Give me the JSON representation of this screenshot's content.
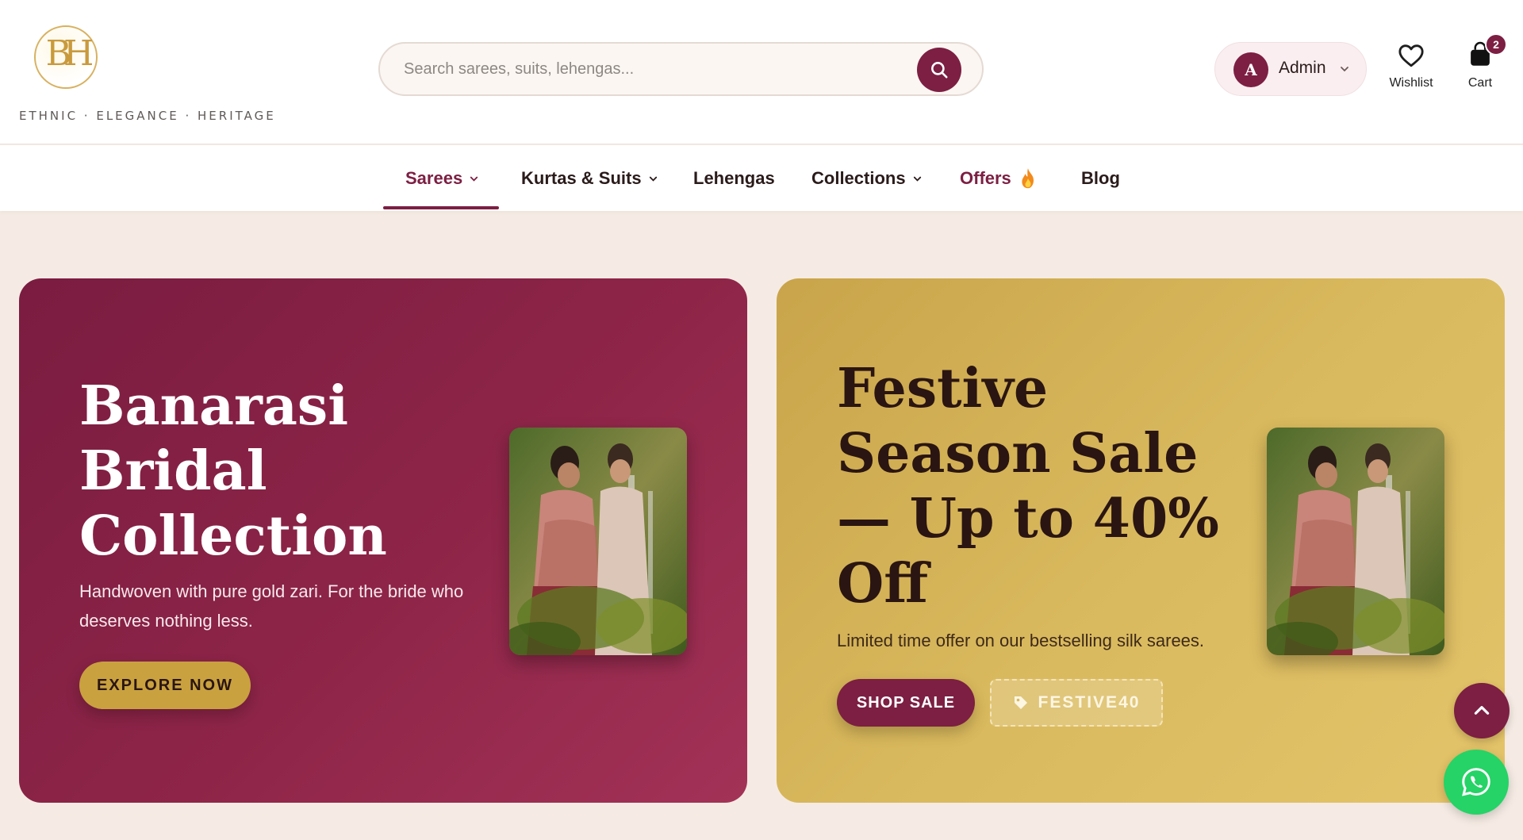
{
  "brand": {
    "monogram": "BH",
    "tagline": "ETHNIC · ELEGANCE · HERITAGE"
  },
  "search": {
    "placeholder": "Search sarees, suits, lehengas...",
    "value": ""
  },
  "account": {
    "initial": "A",
    "name": "Admin"
  },
  "header_actions": {
    "wishlist_label": "Wishlist",
    "cart_label": "Cart",
    "cart_count": "2"
  },
  "nav": {
    "items": [
      {
        "label": "Sarees",
        "has_dropdown": true,
        "active": true
      },
      {
        "label": "Kurtas & Suits",
        "has_dropdown": true
      },
      {
        "label": "Lehengas",
        "has_dropdown": false
      },
      {
        "label": "Collections",
        "has_dropdown": true
      },
      {
        "label": "Offers",
        "has_dropdown": false,
        "icon": "fire-icon"
      },
      {
        "label": "Blog",
        "has_dropdown": false
      }
    ]
  },
  "banners": [
    {
      "title": "Banarasi Bridal Collection",
      "subtitle": "Handwoven with pure gold zari. For the bride who deserves nothing less.",
      "cta": "EXPLORE NOW"
    },
    {
      "title": "Festive Season Sale — Up to 40% Off",
      "subtitle": "Limited time offer on our bestselling silk sarees.",
      "cta": "SHOP SALE",
      "coupon": "FESTIVE40"
    }
  ],
  "colors": {
    "primary": "#7c1f42",
    "gold": "#c9a13f",
    "page_bg": "#f5ebe4",
    "whatsapp": "#25d366"
  }
}
